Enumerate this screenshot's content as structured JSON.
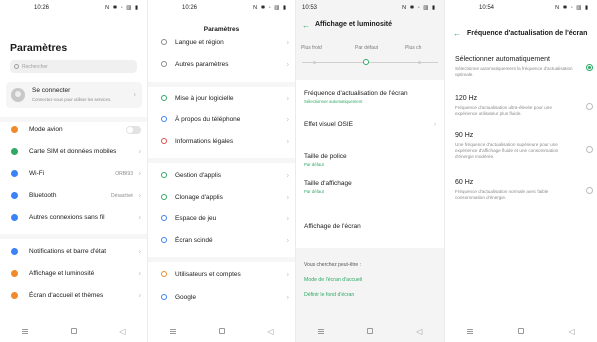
{
  "accent_color": "#2fa866",
  "panel1": {
    "status": {
      "time": "10:26",
      "icons": "N ✱ ◦ ▥ ▮"
    },
    "title": "Paramètres",
    "search_placeholder": "Rechercher",
    "account": {
      "title": "Se connecter",
      "subtitle": "Connectez-vous pour utiliser les services."
    },
    "items": [
      {
        "label": "Mode avion",
        "icon": "airplane-icon",
        "color": "#f08a2c",
        "control": "toggle",
        "enabled": false
      },
      {
        "label": "Carte SIM et données mobiles",
        "icon": "sim-card-icon",
        "color": "#2fa866"
      },
      {
        "label": "Wi-Fi",
        "icon": "wifi-icon",
        "color": "#3b82f6",
        "value": "ORBI93"
      },
      {
        "label": "Bluetooth",
        "icon": "bluetooth-icon",
        "color": "#3b82f6",
        "value": "Désactivé"
      },
      {
        "label": "Autres connexions sans fil",
        "icon": "connections-icon",
        "color": "#3b82f6"
      },
      {
        "label": "Notifications et barre d'état",
        "icon": "notifications-icon",
        "color": "#3b82f6"
      },
      {
        "label": "Affichage et luminosité",
        "icon": "brightness-icon",
        "color": "#f08a2c"
      },
      {
        "label": "Écran d'accueil et thèmes",
        "icon": "home-screen-icon",
        "color": "#f08a2c"
      }
    ]
  },
  "panel2": {
    "status": {
      "time": "10:26",
      "icons": "N ✱ ◦ ▥ ▮"
    },
    "title": "Paramètres",
    "items": [
      {
        "label": "Langue et région",
        "icon": "language-icon",
        "color": "#8a8a8a"
      },
      {
        "label": "Autres paramètres",
        "icon": "more-settings-icon",
        "color": "#8a8a8a"
      },
      {
        "label": "Mise à jour logicielle",
        "icon": "update-icon",
        "color": "#2fa866"
      },
      {
        "label": "À propos du téléphone",
        "icon": "info-icon",
        "color": "#3b82f6"
      },
      {
        "label": "Informations légales",
        "icon": "legal-icon",
        "color": "#e34a4a"
      },
      {
        "label": "Gestion d'applis",
        "icon": "apps-icon",
        "color": "#2fa866"
      },
      {
        "label": "Clonage d'applis",
        "icon": "clone-icon",
        "color": "#2fa866"
      },
      {
        "label": "Espace de jeu",
        "icon": "game-icon",
        "color": "#3b82f6"
      },
      {
        "label": "Écran scindé",
        "icon": "split-screen-icon",
        "color": "#3b82f6"
      },
      {
        "label": "Utilisateurs et comptes",
        "icon": "users-icon",
        "color": "#f08a2c"
      },
      {
        "label": "Google",
        "icon": "google-icon",
        "color": "#3b82f6"
      }
    ]
  },
  "panel3": {
    "status": {
      "time": "10:53",
      "icons": "N ✱ ◦ ▥ ▮"
    },
    "title": "Affichage et luminosité",
    "slider": {
      "labels": [
        "Plus froid",
        "Par défaut",
        "Plus ch"
      ],
      "value_label": "Par défaut"
    },
    "items": [
      {
        "label": "Fréquence d'actualisation de l'écran",
        "sub": "Sélectionner automatiquement"
      },
      {
        "label": "Effet visuel OSIE",
        "sub": ""
      },
      {
        "label": "Taille de police",
        "sub": "Par défaut"
      },
      {
        "label": "Taille d'affichage",
        "sub": "Par défaut"
      },
      {
        "label": "Affichage de l'écran",
        "sub": ""
      }
    ],
    "suggest_title": "Vous cherchez peut-être :",
    "suggest_links": [
      "Mode de l'écran d'accueil",
      "Définir le fond d'écran"
    ]
  },
  "panel4": {
    "status": {
      "time": "10:54",
      "icons": "N ✱ ◦ ▥ ▮"
    },
    "title": "Fréquence d'actualisation de l'écran",
    "options": [
      {
        "label": "Sélectionner automatiquement",
        "desc": "Sélectionne automatiquement la fréquence d'actualisation optimale.",
        "selected": true
      },
      {
        "label": "120 Hz",
        "desc": "Fréquence d'actualisation ultra-élevée pour une expérience utilisateur plus fluide.",
        "selected": false
      },
      {
        "label": "90 Hz",
        "desc": "Une fréquence d'actualisation supérieure pour une expérience d'affichage fluide et une consommation d'énergie modérée.",
        "selected": false
      },
      {
        "label": "60 Hz",
        "desc": "Fréquence d'actualisation normale avec faible consommation d'énergie.",
        "selected": false
      }
    ]
  }
}
